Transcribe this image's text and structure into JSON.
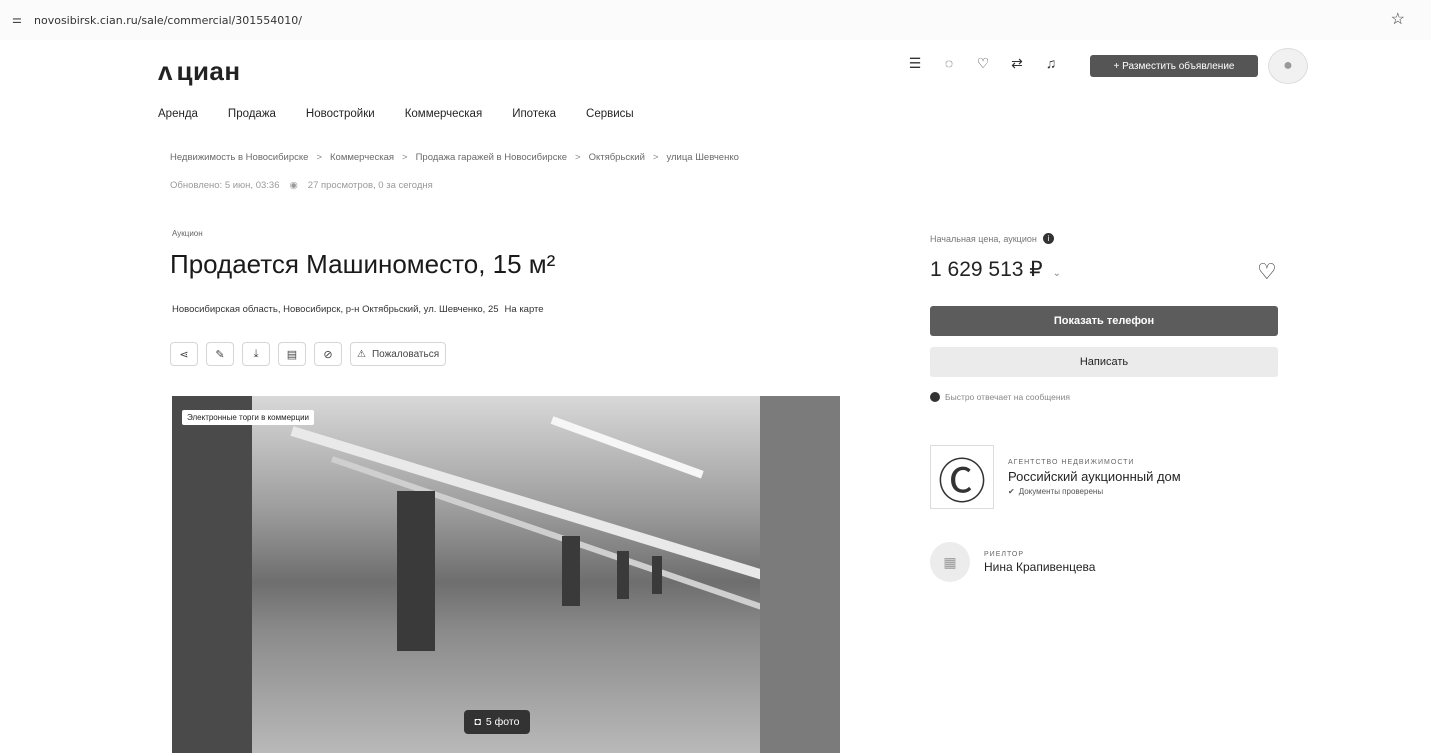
{
  "browser": {
    "url": "novosibirsk.cian.ru/sale/commercial/301554010/",
    "site_icon": "tune-icon",
    "bookmark_icon": "star-icon"
  },
  "header": {
    "logo_text": "циан",
    "icons": [
      "menu-lines-icon",
      "chat-icon",
      "heart-icon",
      "compare-icon",
      "bell-icon"
    ],
    "post_button": "+ Разместить объявление"
  },
  "nav": {
    "items": [
      "Аренда",
      "Продажа",
      "Новостройки",
      "Коммерческая",
      "Ипотека",
      "Сервисы"
    ]
  },
  "breadcrumbs": [
    "Недвижимость в Новосибирске",
    "Коммерческая",
    "Продажа гаражей в Новосибирске",
    "Октябрьский",
    "улица Шевченко"
  ],
  "breadcrumb_sep": ">",
  "meta": {
    "updated": "Обновлено: 5 июн, 03:36",
    "views": "27 просмотров, 0 за сегодня"
  },
  "listing": {
    "tag": "Аукцион",
    "title": "Продается Машиноместо, 15 м²",
    "address": "Новосибирская область, Новосибирск, р-н Октябрьский, ул. Шевченко, 25",
    "map_link": "На карте",
    "report_label": "Пожаловаться"
  },
  "gallery": {
    "badge": "Электронные торги в коммерции",
    "photo_count": "5 фото"
  },
  "price": {
    "label": "Начальная цена, аукцион",
    "value": "1 629 513 ₽"
  },
  "contact": {
    "phone_button": "Показать телефон",
    "write_button": "Написать",
    "fast_reply": "Быстро отвечает на сообщения"
  },
  "agency": {
    "type": "АГЕНТСТВО НЕДВИЖИМОСТИ",
    "name": "Российский аукционный дом",
    "docs": "Документы проверены"
  },
  "realtor": {
    "role": "РИЕЛТОР",
    "name": "Нина Крапивенцева"
  }
}
